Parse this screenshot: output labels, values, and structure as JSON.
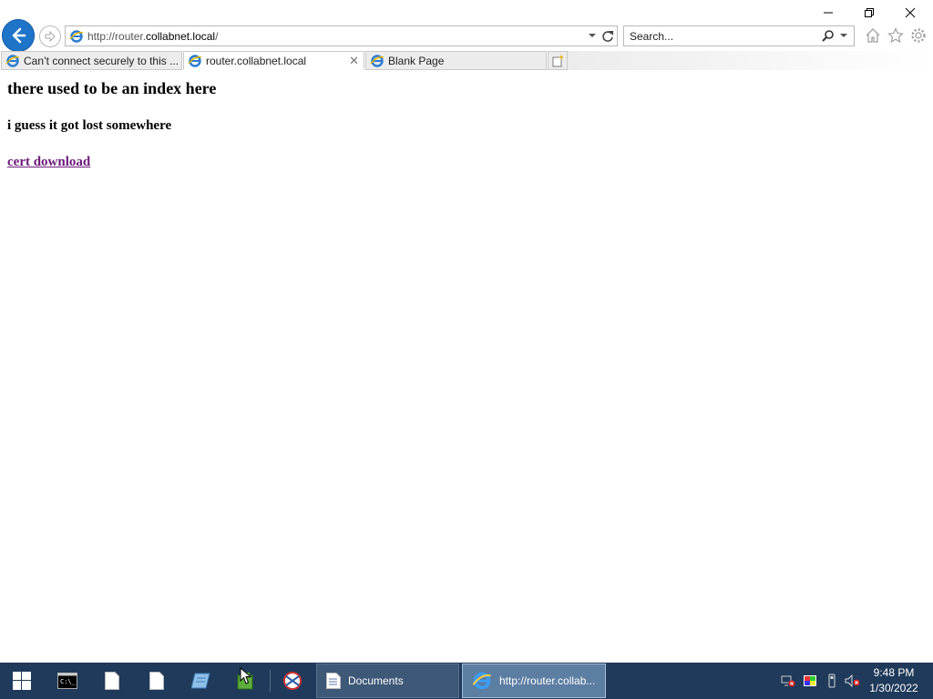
{
  "window": {
    "minimize_icon": "minimize-icon",
    "maximize_icon": "restore-icon",
    "close_icon": "close-icon"
  },
  "nav": {
    "address_prefix": "http://router.",
    "address_host": "collabnet.local",
    "address_suffix": "/",
    "search_placeholder": "Search..."
  },
  "tabs": [
    {
      "label": "Can’t connect securely to this ...",
      "active": false
    },
    {
      "label": "router.collabnet.local",
      "active": true
    },
    {
      "label": "Blank Page",
      "active": false
    }
  ],
  "page": {
    "heading": "there used to be an index here",
    "subheading": "i guess it got lost somewhere",
    "link_text": "cert download"
  },
  "taskbar": {
    "documents_label": "Documents",
    "browser_label": "http://router.collab...",
    "time": "9:48 PM",
    "date": "1/30/2022"
  },
  "colors": {
    "accent": "#1e74c8",
    "visited_link": "#6b1a7a",
    "taskbar": "#1f3a5a"
  }
}
